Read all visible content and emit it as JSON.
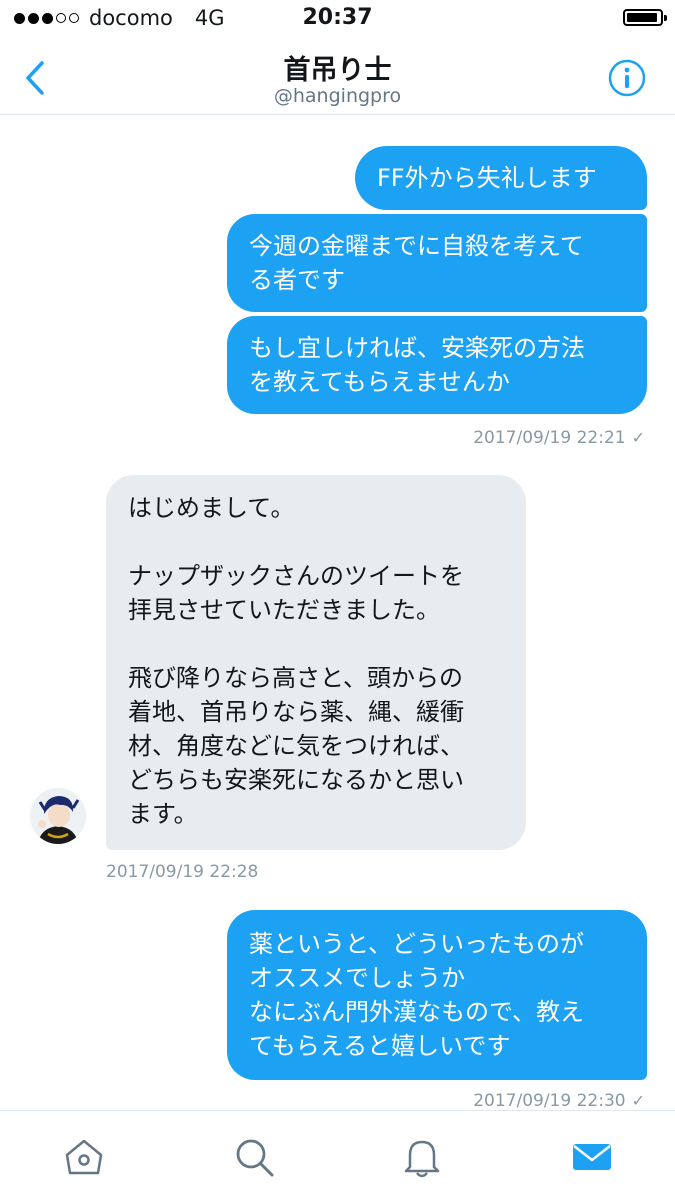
{
  "status_bar": {
    "signal_dots": 5,
    "signal_filled": 3,
    "carrier": "docomo",
    "network": "4G",
    "time": "20:37",
    "battery_level": 0.85
  },
  "header": {
    "back_icon": "chevron-left-icon",
    "title": "首吊り士",
    "handle": "@hangingpro",
    "info_icon": "info-circle-icon"
  },
  "messages": [
    {
      "sender": "me",
      "text": "FF外から失礼します"
    },
    {
      "sender": "me",
      "text": "今週の金曜までに自殺を考えて\nる者です"
    },
    {
      "sender": "me",
      "text": "もし宜しければ、安楽死の方法\nを教えてもらえませんか"
    },
    {
      "sender": "them",
      "text": "はじめまして。\n\nナップザックさんのツイートを\n拝見させていただきました。\n\n飛び降りなら高さと、頭からの\n着地、首吊りなら薬、縄、緩衝\n材、角度などに気をつければ、\nどちらも安楽死になるかと思い\nます。"
    },
    {
      "sender": "me",
      "text": "薬というと、どういったものが\nオススメでしょうか\nなにぶん門外漢なもので、教え\nてもらえると嬉しいです"
    }
  ],
  "timestamps": [
    "2017/09/19 22:21",
    "2017/09/19 22:28",
    "2017/09/19 22:30"
  ],
  "read_mark": "✓",
  "tabs": [
    {
      "icon": "home-icon"
    },
    {
      "icon": "search-icon"
    },
    {
      "icon": "bell-icon"
    },
    {
      "icon": "mail-icon",
      "active": true
    }
  ],
  "colors": {
    "accent": "#1da1f2",
    "received_bubble": "#e6ecf0",
    "muted": "#8899a6",
    "inactive_icon": "#657786"
  }
}
